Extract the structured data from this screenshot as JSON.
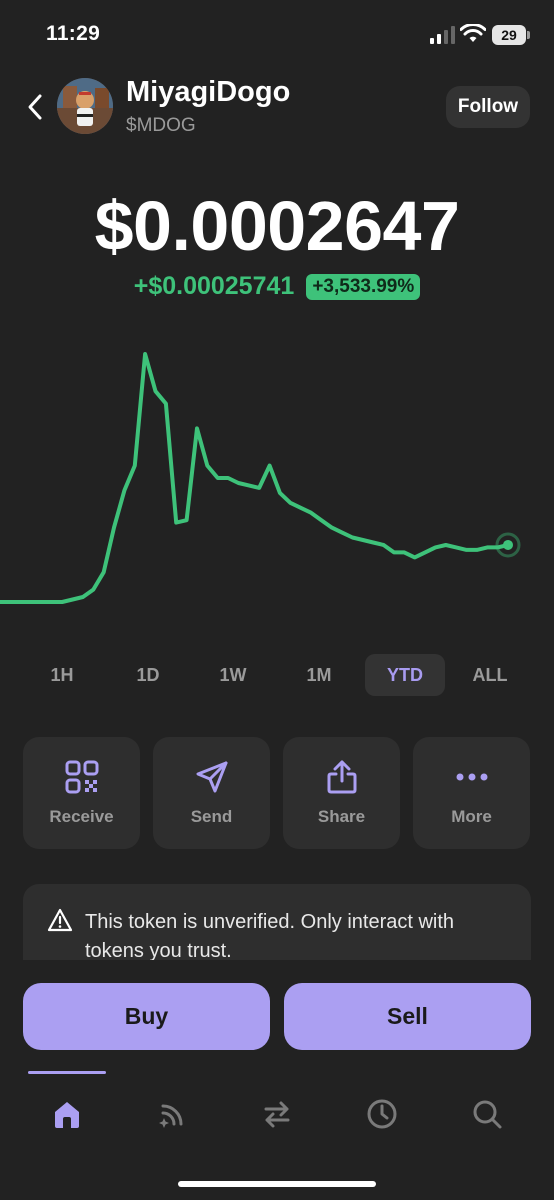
{
  "status_bar": {
    "time": "11:29",
    "battery": "29"
  },
  "header": {
    "token_name": "MiyagiDogo",
    "token_symbol": "$MDOG",
    "follow_label": "Follow"
  },
  "price": {
    "value": "$0.0002647",
    "change_abs": "+$0.00025741",
    "change_pct": "+3,533.99%",
    "change_color": "#3ec27a"
  },
  "chart_data": {
    "type": "line",
    "trend_shape": [
      0.0,
      0.0,
      0.0,
      0.0,
      0.0,
      0.0,
      0.0,
      0.01,
      0.02,
      0.05,
      0.12,
      0.3,
      0.45,
      0.55,
      1.0,
      0.85,
      0.8,
      0.32,
      0.33,
      0.7,
      0.55,
      0.5,
      0.5,
      0.48,
      0.47,
      0.46,
      0.55,
      0.44,
      0.4,
      0.38,
      0.36,
      0.33,
      0.3,
      0.28,
      0.26,
      0.25,
      0.24,
      0.23,
      0.2,
      0.2,
      0.18,
      0.2,
      0.22,
      0.23,
      0.22,
      0.21,
      0.21,
      0.22,
      0.22,
      0.23
    ],
    "line_color": "#3ec27a"
  },
  "range_tabs": [
    {
      "label": "1H",
      "active": false
    },
    {
      "label": "1D",
      "active": false
    },
    {
      "label": "1W",
      "active": false
    },
    {
      "label": "1M",
      "active": false
    },
    {
      "label": "YTD",
      "active": true
    },
    {
      "label": "ALL",
      "active": false
    }
  ],
  "actions": [
    {
      "label": "Receive",
      "icon": "qr-code-icon"
    },
    {
      "label": "Send",
      "icon": "send-icon"
    },
    {
      "label": "Share",
      "icon": "share-icon"
    },
    {
      "label": "More",
      "icon": "more-icon"
    }
  ],
  "warning": {
    "text": "This token is unverified. Only interact with tokens you trust.",
    "icon": "warning-icon"
  },
  "trade": {
    "buy_label": "Buy",
    "sell_label": "Sell",
    "accent": "#ab9ff2"
  },
  "bottom_nav": [
    {
      "icon": "home-icon",
      "active": true
    },
    {
      "icon": "explore-icon",
      "active": false
    },
    {
      "icon": "swap-icon",
      "active": false
    },
    {
      "icon": "history-icon",
      "active": false
    },
    {
      "icon": "search-icon",
      "active": false
    }
  ]
}
